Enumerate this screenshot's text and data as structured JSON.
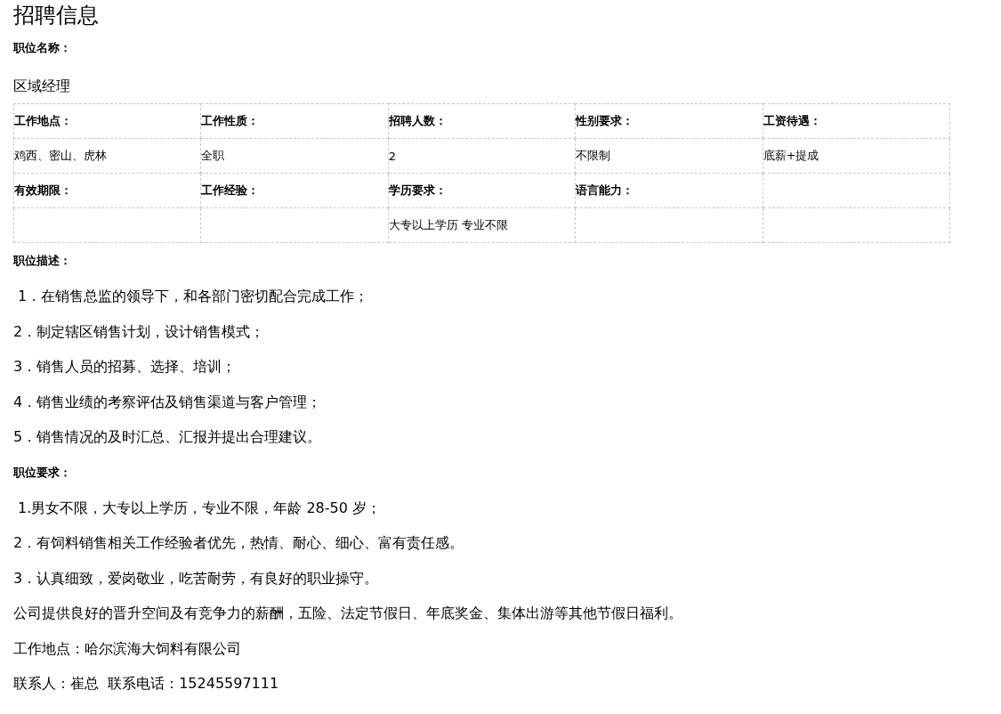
{
  "title": "招聘信息",
  "position": {
    "label": "职位名称：",
    "value": "区域经理"
  },
  "table": {
    "rows": [
      {
        "kind": "label",
        "cells": [
          "工作地点：",
          "工作性质：",
          "招聘人数：",
          "性别要求：",
          "工资待遇："
        ]
      },
      {
        "kind": "value",
        "cells": [
          "鸡西、密山、虎林",
          "全职",
          "2",
          "不限制",
          "底薪+提成"
        ]
      },
      {
        "kind": "label",
        "cells": [
          "有效期限：",
          "工作经验：",
          "学历要求：",
          "语言能力：",
          null
        ]
      },
      {
        "kind": "value",
        "cells": [
          null,
          null,
          "大专以上学历  专业不限",
          null,
          null
        ]
      }
    ]
  },
  "description": {
    "heading": "职位描述：",
    "items": [
      " 1．在销售总监的领导下，和各部门密切配合完成工作；",
      "2．制定辖区销售计划，设计销售模式；",
      "3．销售人员的招募、选择、培训；",
      "4．销售业绩的考察评估及销售渠道与客户管理；",
      "5．销售情况的及时汇总、汇报并提出合理建议。"
    ]
  },
  "requirements": {
    "heading": "职位要求：",
    "items": [
      " 1.男女不限，大专以上学历，专业不限，年龄 28-50 岁；",
      "2．有饲料销售相关工作经验者优先，热情、耐心、细心、富有责任感。",
      "3．认真细致，爱岗敬业，吃苦耐劳，有良好的职业操守。"
    ]
  },
  "paragraphs": [
    "公司提供良好的晋升空间及有竞争力的薪酬，五险、法定节假日、年底奖金、集体出游等其他节假日福利。",
    "工作地点：哈尔滨海大饲料有限公司",
    "联系人：崔总  联系电话：15245597111"
  ]
}
